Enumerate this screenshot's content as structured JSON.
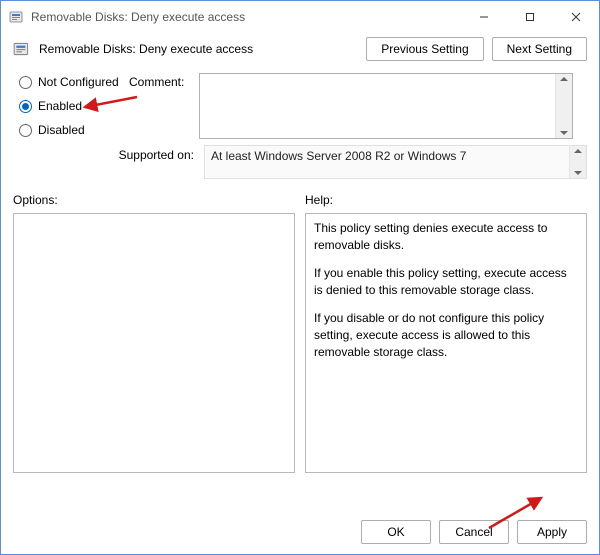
{
  "window": {
    "title": "Removable Disks: Deny execute access"
  },
  "header": {
    "subtitle": "Removable Disks: Deny execute access",
    "prev_label": "Previous Setting",
    "next_label": "Next Setting"
  },
  "state": {
    "not_configured_label": "Not Configured",
    "enabled_label": "Enabled",
    "disabled_label": "Disabled",
    "selected": "enabled"
  },
  "comment": {
    "label": "Comment:",
    "value": ""
  },
  "supported": {
    "label": "Supported on:",
    "value": "At least Windows Server 2008 R2 or Windows 7"
  },
  "lower": {
    "options_label": "Options:",
    "help_label": "Help:",
    "help_text": {
      "p1": "This policy setting denies execute access to removable disks.",
      "p2": "If you enable this policy setting, execute access is denied to this removable storage class.",
      "p3": "If you disable or do not configure this policy setting, execute access is allowed to this removable storage class."
    }
  },
  "footer": {
    "ok": "OK",
    "cancel": "Cancel",
    "apply": "Apply"
  },
  "annotations": {
    "arrow_color": "#d11919"
  }
}
